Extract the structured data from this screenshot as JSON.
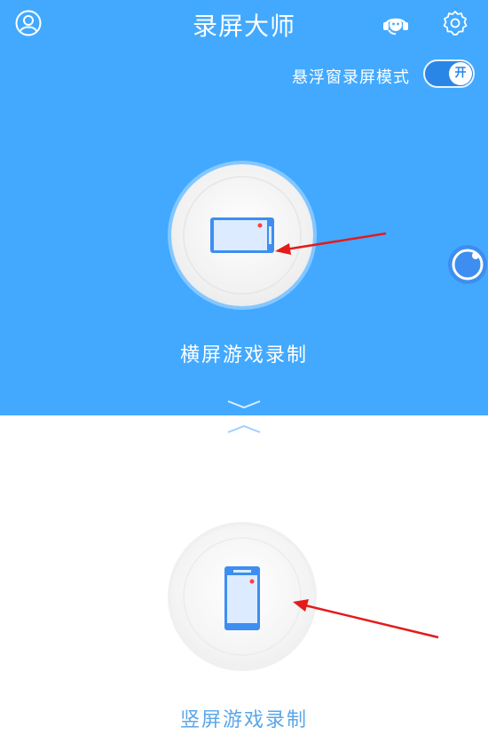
{
  "header": {
    "title": "录屏大师",
    "profile_icon": "user-profile-icon",
    "support_icon": "headset-support-icon",
    "settings_icon": "gear-icon"
  },
  "floating_mode": {
    "label": "悬浮窗录屏模式",
    "toggle_text": "开",
    "enabled": true
  },
  "landscape": {
    "label": "横屏游戏录制",
    "icon": "landscape-phone-icon"
  },
  "portrait": {
    "label": "竖屏游戏录制",
    "icon": "portrait-phone-icon"
  },
  "colors": {
    "primary_blue": "#42a9ff",
    "phone_blue": "#3d8ef0",
    "record_dot": "#ff4040",
    "annotation_arrow": "#e31b1b",
    "bottom_label": "#5aa7e8"
  }
}
